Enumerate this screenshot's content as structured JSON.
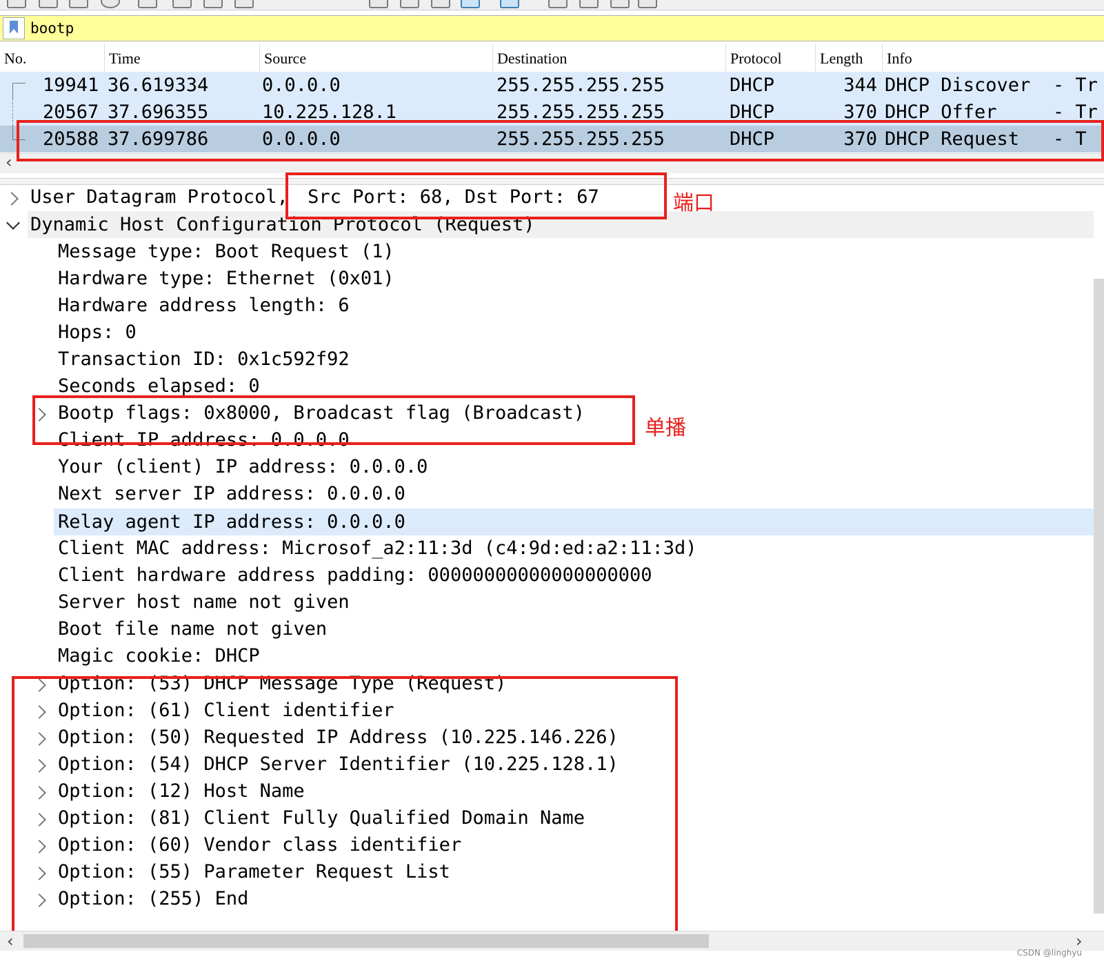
{
  "filter": {
    "value": "bootp"
  },
  "columns": [
    "No.",
    "Time",
    "Source",
    "Destination",
    "Protocol",
    "Length",
    "Info"
  ],
  "packets": [
    {
      "no": "19941",
      "time": "36.619334",
      "source": "0.0.0.0",
      "destination": "255.255.255.255",
      "protocol": "DHCP",
      "length": "344",
      "info": "DHCP Discover  - Tr"
    },
    {
      "no": "20567",
      "time": "37.696355",
      "source": "10.225.128.1",
      "destination": "255.255.255.255",
      "protocol": "DHCP",
      "length": "370",
      "info": "DHCP Offer     - Tr"
    },
    {
      "no": "20588",
      "time": "37.699786",
      "source": "0.0.0.0",
      "destination": "255.255.255.255",
      "protocol": "DHCP",
      "length": "370",
      "info": "DHCP Request   - T"
    }
  ],
  "tree": {
    "udp": {
      "label": "User Datagram Protocol,",
      "ports": "Src Port: 68, Dst Port: 67"
    },
    "dhcp": {
      "label": "Dynamic Host Configuration Protocol (Request)"
    },
    "fields": [
      "Message type: Boot Request (1)",
      "Hardware type: Ethernet (0x01)",
      "Hardware address length: 6",
      "Hops: 0",
      "Transaction ID: 0x1c592f92",
      "Seconds elapsed: 0",
      "Bootp flags: 0x8000, Broadcast flag (Broadcast)",
      "Client IP address: 0.0.0.0",
      "Your (client) IP address: 0.0.0.0",
      "Next server IP address: 0.0.0.0",
      "Relay agent IP address: 0.0.0.0",
      "Client MAC address: Microsof_a2:11:3d (c4:9d:ed:a2:11:3d)",
      "Client hardware address padding: 00000000000000000000",
      "Server host name not given",
      "Boot file name not given",
      "Magic cookie: DHCP"
    ],
    "options": [
      "Option: (53) DHCP Message Type (Request)",
      "Option: (61) Client identifier",
      "Option: (50) Requested IP Address (10.225.146.226)",
      "Option: (54) DHCP Server Identifier (10.225.128.1)",
      "Option: (12) Host Name",
      "Option: (81) Client Fully Qualified Domain Name",
      "Option: (60) Vendor class identifier",
      "Option: (55) Parameter Request List",
      "Option: (255) End"
    ]
  },
  "annotations": {
    "port": "端口",
    "flags": "单播"
  },
  "watermark": "CSDN @linghyu",
  "colors": {
    "accent_red": "#e8201c",
    "row_highlight": "#dcebfc",
    "row_selected": "#b9cde0",
    "filter_bg": "#ffff99"
  }
}
